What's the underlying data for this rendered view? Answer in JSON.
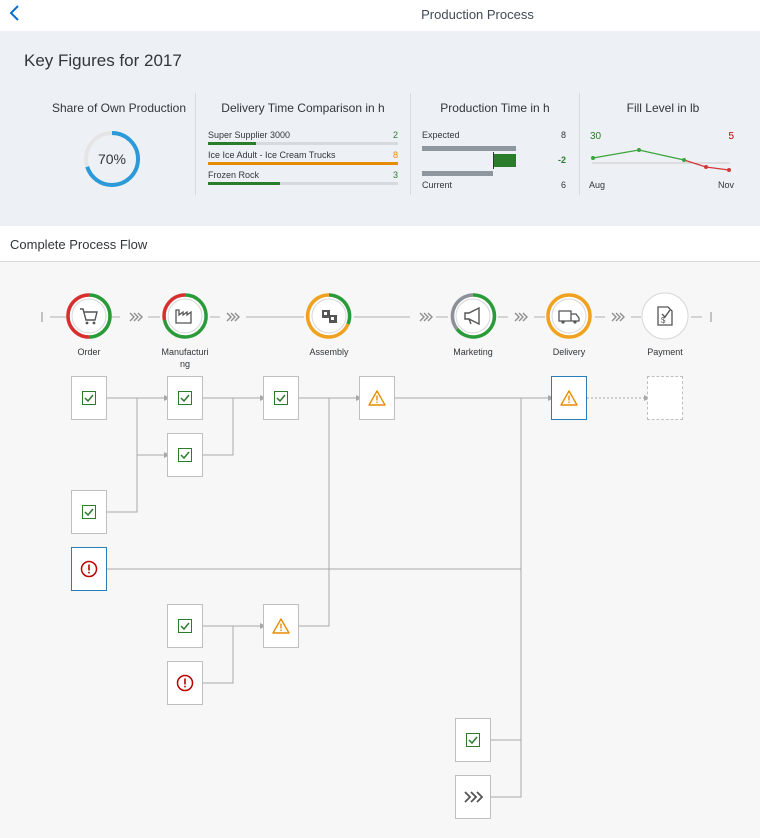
{
  "header": {
    "title": "Production Process"
  },
  "key_figures": {
    "title": "Key Figures for 2017",
    "share": {
      "title": "Share of Own Production",
      "value_label": "70%",
      "value": 70
    },
    "delivery": {
      "title": "Delivery Time Comparison in h",
      "items": [
        {
          "label": "Super Supplier 3000",
          "value": "2",
          "fill": 0.25,
          "color": "#2b7c2b"
        },
        {
          "label": "Ice Ice Adult - Ice Cream Trucks",
          "value": "8",
          "fill": 1.0,
          "color": "#e78c07"
        },
        {
          "label": "Frozen Rock",
          "value": "3",
          "fill": 0.38,
          "color": "#2b7c2b"
        }
      ]
    },
    "production": {
      "title": "Production Time in h",
      "expected_label": "Expected",
      "expected_value": "8",
      "diff_value": "-2",
      "current_label": "Current",
      "current_value": "6"
    },
    "fill_level": {
      "title": "Fill Level in lb",
      "start_value": "30",
      "end_value": "5",
      "start_label": "Aug",
      "end_label": "Nov"
    }
  },
  "process_flow": {
    "title": "Complete Process Flow",
    "lanes": [
      {
        "label": "Order",
        "icon": "cart-icon"
      },
      {
        "label": "Manufacturi\nng",
        "icon": "factory-icon"
      },
      {
        "label": "Assembly",
        "icon": "assembly-icon"
      },
      {
        "label": "Marketing",
        "icon": "megaphone-icon"
      },
      {
        "label": "Delivery",
        "icon": "truck-icon"
      },
      {
        "label": "Payment",
        "icon": "payment-icon"
      }
    ]
  },
  "colors": {
    "positive": "#2b7c2b",
    "critical": "#e78c07",
    "negative": "#bb0000",
    "accent": "#0a6ed1"
  }
}
